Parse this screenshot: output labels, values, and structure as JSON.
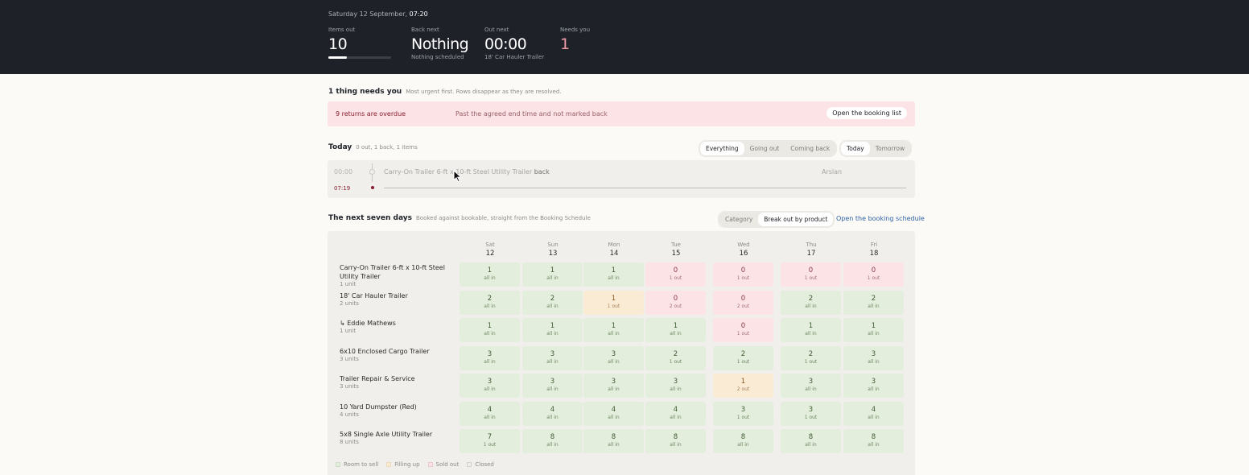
{
  "header": {
    "date_prefix": "Saturday 12 September,",
    "time": "07:20",
    "stats": [
      {
        "label": "Items out",
        "value": "10",
        "progress": 0.3
      },
      {
        "label": "Back next",
        "value": "Nothing",
        "sub": "Nothing scheduled"
      },
      {
        "label": "Out next",
        "value": "00:00",
        "sub": "18' Car Hauler Trailer"
      },
      {
        "label": "Needs you",
        "value": "1"
      }
    ]
  },
  "needs": {
    "title": "1 thing needs you",
    "subtitle": "Most urgent first. Rows disappear as they are resolved.",
    "alert": {
      "title": "9 returns are overdue",
      "description": "Past the agreed end time and not marked back",
      "button": "Open the booking list"
    }
  },
  "today": {
    "title": "Today",
    "subtitle": "0 out, 1 back, 1 items",
    "filters": [
      "Everything",
      "Going out",
      "Coming back"
    ],
    "filter_selected": "Everything",
    "days": [
      "Today",
      "Tomorrow"
    ],
    "day_selected": "Today",
    "event": {
      "time": "00:00",
      "item": "Carry-On Trailer 6-ft x 10-ft Steel Utility Trailer",
      "action": "back",
      "person": "Arslan"
    },
    "now": "07:19"
  },
  "seven": {
    "title": "The next seven days",
    "subtitle": "Booked against bookable, straight from the Booking Schedule",
    "views": [
      "Category",
      "Break out by product"
    ],
    "view_selected": "Break out by product",
    "link": "Open the booking schedule",
    "days": [
      {
        "dw": "Sat",
        "dn": "12"
      },
      {
        "dw": "Sun",
        "dn": "13"
      },
      {
        "dw": "Mon",
        "dn": "14"
      },
      {
        "dw": "Tue",
        "dn": "15"
      },
      {
        "dw": "Wed",
        "dn": "16"
      },
      {
        "dw": "Thu",
        "dn": "17"
      },
      {
        "dw": "Fri",
        "dn": "18"
      }
    ],
    "rows": [
      {
        "name": "Carry-On Trailer 6-ft x 10-ft Steel Utility Trailer",
        "units": "1 unit",
        "cells": [
          {
            "v": "1",
            "s": "all in",
            "st": "room"
          },
          {
            "v": "1",
            "s": "all in",
            "st": "room"
          },
          {
            "v": "1",
            "s": "all in",
            "st": "room"
          },
          {
            "v": "0",
            "s": "1 out",
            "st": "sold"
          },
          {
            "v": "0",
            "s": "1 out",
            "st": "sold"
          },
          {
            "v": "0",
            "s": "1 out",
            "st": "sold"
          },
          {
            "v": "0",
            "s": "1 out",
            "st": "sold"
          }
        ]
      },
      {
        "name": "18' Car Hauler Trailer",
        "units": "2 units",
        "cells": [
          {
            "v": "2",
            "s": "all in",
            "st": "room"
          },
          {
            "v": "2",
            "s": "all in",
            "st": "room"
          },
          {
            "v": "1",
            "s": "1 out",
            "st": "fill"
          },
          {
            "v": "0",
            "s": "2 out",
            "st": "sold"
          },
          {
            "v": "0",
            "s": "2 out",
            "st": "sold"
          },
          {
            "v": "2",
            "s": "all in",
            "st": "room"
          },
          {
            "v": "2",
            "s": "all in",
            "st": "room"
          }
        ]
      },
      {
        "name": "↳ Eddie Mathews",
        "units": "1 unit",
        "cells": [
          {
            "v": "1",
            "s": "all in",
            "st": "room"
          },
          {
            "v": "1",
            "s": "all in",
            "st": "room"
          },
          {
            "v": "1",
            "s": "all in",
            "st": "room"
          },
          {
            "v": "1",
            "s": "all in",
            "st": "room"
          },
          {
            "v": "0",
            "s": "1 out",
            "st": "sold"
          },
          {
            "v": "1",
            "s": "all in",
            "st": "room"
          },
          {
            "v": "1",
            "s": "all in",
            "st": "room"
          }
        ]
      },
      {
        "name": "6x10 Enclosed Cargo Trailer",
        "units": "3 units",
        "cells": [
          {
            "v": "3",
            "s": "all in",
            "st": "room"
          },
          {
            "v": "3",
            "s": "all in",
            "st": "room"
          },
          {
            "v": "3",
            "s": "all in",
            "st": "room"
          },
          {
            "v": "2",
            "s": "1 out",
            "st": "room"
          },
          {
            "v": "2",
            "s": "1 out",
            "st": "room"
          },
          {
            "v": "2",
            "s": "1 out",
            "st": "room"
          },
          {
            "v": "3",
            "s": "all in",
            "st": "room"
          }
        ]
      },
      {
        "name": "Trailer Repair & Service",
        "units": "3 units",
        "cells": [
          {
            "v": "3",
            "s": "all in",
            "st": "room"
          },
          {
            "v": "3",
            "s": "all in",
            "st": "room"
          },
          {
            "v": "3",
            "s": "all in",
            "st": "room"
          },
          {
            "v": "3",
            "s": "all in",
            "st": "room"
          },
          {
            "v": "1",
            "s": "2 out",
            "st": "fill"
          },
          {
            "v": "3",
            "s": "all in",
            "st": "room"
          },
          {
            "v": "3",
            "s": "all in",
            "st": "room"
          }
        ]
      },
      {
        "name": "10 Yard Dumpster (Red)",
        "units": "4 units",
        "cells": [
          {
            "v": "4",
            "s": "all in",
            "st": "room"
          },
          {
            "v": "4",
            "s": "all in",
            "st": "room"
          },
          {
            "v": "4",
            "s": "all in",
            "st": "room"
          },
          {
            "v": "4",
            "s": "all in",
            "st": "room"
          },
          {
            "v": "3",
            "s": "1 out",
            "st": "room"
          },
          {
            "v": "3",
            "s": "1 out",
            "st": "room"
          },
          {
            "v": "4",
            "s": "all in",
            "st": "room"
          }
        ]
      },
      {
        "name": "5x8 Single Axle Utility Trailer",
        "units": "8 units",
        "cells": [
          {
            "v": "7",
            "s": "1 out",
            "st": "room"
          },
          {
            "v": "8",
            "s": "all in",
            "st": "room"
          },
          {
            "v": "8",
            "s": "all in",
            "st": "room"
          },
          {
            "v": "8",
            "s": "all in",
            "st": "room"
          },
          {
            "v": "8",
            "s": "all in",
            "st": "room"
          },
          {
            "v": "8",
            "s": "all in",
            "st": "room"
          },
          {
            "v": "8",
            "s": "all in",
            "st": "room"
          }
        ]
      }
    ],
    "legend": [
      {
        "key": "room",
        "label": "Room to sell"
      },
      {
        "key": "fill",
        "label": "Filling up"
      },
      {
        "key": "sold",
        "label": "Sold out"
      },
      {
        "key": "closed",
        "label": "Closed"
      }
    ]
  }
}
